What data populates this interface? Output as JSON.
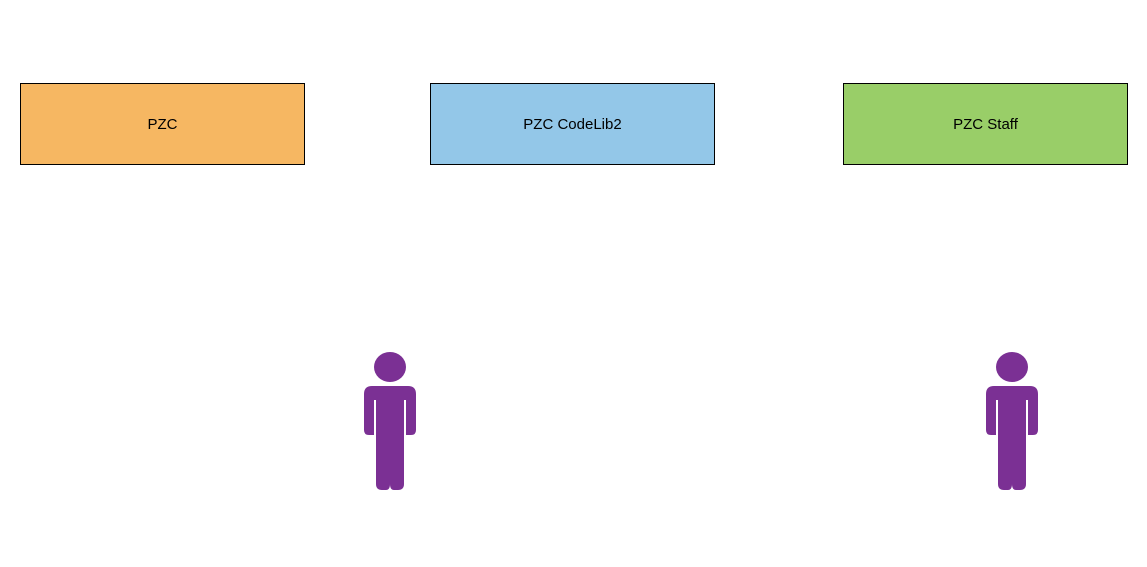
{
  "boxes": {
    "pzc": {
      "label": "PZC"
    },
    "codelib": {
      "label": "PZC CodeLib2"
    },
    "staff": {
      "label": "PZC Staff"
    }
  },
  "colors": {
    "pzc_bg": "#f6b762",
    "codelib_bg": "#93c7e8",
    "staff_bg": "#99ce68",
    "person_fill": "#7b3094",
    "border": "#000000"
  },
  "people": [
    {
      "id": "person-1"
    },
    {
      "id": "person-2"
    }
  ]
}
